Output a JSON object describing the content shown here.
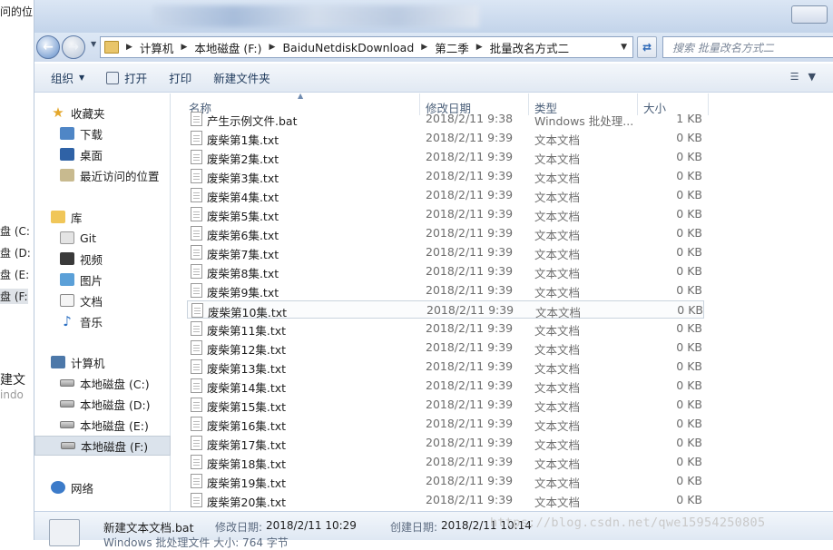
{
  "background_window": {
    "top_text": "问的位",
    "items": [
      {
        "label": "盘 (C:",
        "top": 0
      },
      {
        "label": "盘 (D:",
        "top": 0
      },
      {
        "label": "盘 (E:",
        "top": 0
      },
      {
        "label": "盘 (F:",
        "top": 0
      },
      {
        "label": "建文",
        "top": 0
      },
      {
        "label": "indo",
        "top": 0
      }
    ]
  },
  "address": {
    "crumbs": [
      "计算机",
      "本地磁盘 (F:)",
      "BaiduNetdiskDownload",
      "第二季",
      "批量改名方式二"
    ]
  },
  "search": {
    "placeholder": "搜索 批量改名方式二"
  },
  "toolbar": {
    "organize": "组织",
    "open": "打开",
    "print": "打印",
    "new_folder": "新建文件夹"
  },
  "nav": {
    "favorites": "收藏夹",
    "downloads": "下载",
    "desktop": "桌面",
    "recent": "最近访问的位置",
    "libraries": "库",
    "git": "Git",
    "videos": "视频",
    "pictures": "图片",
    "documents": "文档",
    "music": "音乐",
    "computer": "计算机",
    "drive_c": "本地磁盘 (C:)",
    "drive_d": "本地磁盘 (D:)",
    "drive_e": "本地磁盘 (E:)",
    "drive_f": "本地磁盘 (F:)",
    "network": "网络"
  },
  "columns": {
    "name": "名称",
    "date": "修改日期",
    "type": "类型",
    "size": "大小"
  },
  "partial_row": {
    "name": "产生示例文件.bat",
    "date": "2018/2/11 9:38",
    "type": "Windows 批处理...",
    "size": "1 KB"
  },
  "files": [
    {
      "name": "废柴第1集.txt",
      "date": "2018/2/11 9:39",
      "type": "文本文档",
      "size": "0 KB"
    },
    {
      "name": "废柴第2集.txt",
      "date": "2018/2/11 9:39",
      "type": "文本文档",
      "size": "0 KB"
    },
    {
      "name": "废柴第3集.txt",
      "date": "2018/2/11 9:39",
      "type": "文本文档",
      "size": "0 KB"
    },
    {
      "name": "废柴第4集.txt",
      "date": "2018/2/11 9:39",
      "type": "文本文档",
      "size": "0 KB"
    },
    {
      "name": "废柴第5集.txt",
      "date": "2018/2/11 9:39",
      "type": "文本文档",
      "size": "0 KB"
    },
    {
      "name": "废柴第6集.txt",
      "date": "2018/2/11 9:39",
      "type": "文本文档",
      "size": "0 KB"
    },
    {
      "name": "废柴第7集.txt",
      "date": "2018/2/11 9:39",
      "type": "文本文档",
      "size": "0 KB"
    },
    {
      "name": "废柴第8集.txt",
      "date": "2018/2/11 9:39",
      "type": "文本文档",
      "size": "0 KB"
    },
    {
      "name": "废柴第9集.txt",
      "date": "2018/2/11 9:39",
      "type": "文本文档",
      "size": "0 KB"
    },
    {
      "name": "废柴第10集.txt",
      "date": "2018/2/11 9:39",
      "type": "文本文档",
      "size": "0 KB",
      "hover": true
    },
    {
      "name": "废柴第11集.txt",
      "date": "2018/2/11 9:39",
      "type": "文本文档",
      "size": "0 KB"
    },
    {
      "name": "废柴第12集.txt",
      "date": "2018/2/11 9:39",
      "type": "文本文档",
      "size": "0 KB"
    },
    {
      "name": "废柴第13集.txt",
      "date": "2018/2/11 9:39",
      "type": "文本文档",
      "size": "0 KB"
    },
    {
      "name": "废柴第14集.txt",
      "date": "2018/2/11 9:39",
      "type": "文本文档",
      "size": "0 KB"
    },
    {
      "name": "废柴第15集.txt",
      "date": "2018/2/11 9:39",
      "type": "文本文档",
      "size": "0 KB"
    },
    {
      "name": "废柴第16集.txt",
      "date": "2018/2/11 9:39",
      "type": "文本文档",
      "size": "0 KB"
    },
    {
      "name": "废柴第17集.txt",
      "date": "2018/2/11 9:39",
      "type": "文本文档",
      "size": "0 KB"
    },
    {
      "name": "废柴第18集.txt",
      "date": "2018/2/11 9:39",
      "type": "文本文档",
      "size": "0 KB"
    },
    {
      "name": "废柴第19集.txt",
      "date": "2018/2/11 9:39",
      "type": "文本文档",
      "size": "0 KB"
    },
    {
      "name": "废柴第20集.txt",
      "date": "2018/2/11 9:39",
      "type": "文本文档",
      "size": "0 KB"
    }
  ],
  "details": {
    "file_name": "新建文本文档.bat",
    "modified_label": "修改日期:",
    "modified_value": "2018/2/11 10:29",
    "created_label": "创建日期:",
    "created_value": "2018/2/11 10:14",
    "line2": "Windows 批处理文件        大小: 764 字节"
  },
  "watermark": "https://blog.csdn.net/qwe15954250805"
}
